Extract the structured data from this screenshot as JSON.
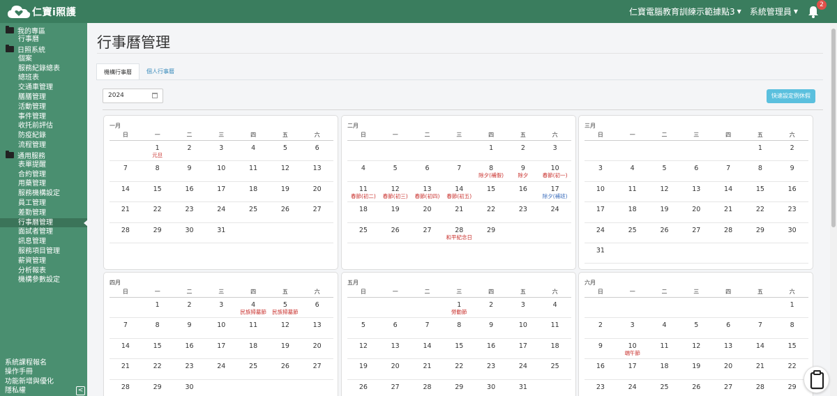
{
  "header": {
    "logo_text": "仁寶i照護",
    "org_selector": "仁寶電腦教育訓練示範據點3",
    "user_menu": "系統管理員",
    "notification_count": "2"
  },
  "sidebar": {
    "groups": [
      {
        "label": "我的專區",
        "items": [
          "行事曆"
        ]
      },
      {
        "label": "日照系統",
        "items": [
          "個案",
          "服務紀錄總表",
          "總班表",
          "交通車管理",
          "膳膳管理",
          "活動管理",
          "事件管理",
          "收托前評估",
          "防疫紀錄",
          "流程管理"
        ]
      },
      {
        "label": "通用服務",
        "items": [
          "表單提醒",
          "合約管理",
          "用藥管理",
          "服務機構設定",
          "員工管理",
          "差勤管理",
          "行事曆管理",
          "面試者管理",
          "訊息管理",
          "服務項目管理",
          "薪資管理",
          "分析報表",
          "機構參數設定"
        ]
      }
    ],
    "active_item": "行事曆管理",
    "bottom_links": [
      "系統課程報名",
      "操作手冊",
      "功能新增與優化",
      "隱私權"
    ]
  },
  "page": {
    "title": "行事曆管理",
    "tabs": [
      "機構行事曆",
      "個人行事曆"
    ],
    "year": "2024",
    "quick_button": "快速設定例休假"
  },
  "calendar": {
    "weekdays": [
      "日",
      "一",
      "二",
      "三",
      "四",
      "五",
      "六"
    ],
    "months": [
      {
        "name": "一月",
        "weeks": [
          [
            {
              "d": ""
            },
            {
              "d": "1",
              "n": "元旦"
            },
            {
              "d": "2"
            },
            {
              "d": "3"
            },
            {
              "d": "4"
            },
            {
              "d": "5"
            },
            {
              "d": "6"
            }
          ],
          [
            {
              "d": "7"
            },
            {
              "d": "8"
            },
            {
              "d": "9"
            },
            {
              "d": "10"
            },
            {
              "d": "11"
            },
            {
              "d": "12"
            },
            {
              "d": "13"
            }
          ],
          [
            {
              "d": "14"
            },
            {
              "d": "15"
            },
            {
              "d": "16"
            },
            {
              "d": "17"
            },
            {
              "d": "18"
            },
            {
              "d": "19"
            },
            {
              "d": "20"
            }
          ],
          [
            {
              "d": "21"
            },
            {
              "d": "22"
            },
            {
              "d": "23"
            },
            {
              "d": "24"
            },
            {
              "d": "25"
            },
            {
              "d": "26"
            },
            {
              "d": "27"
            }
          ],
          [
            {
              "d": "28"
            },
            {
              "d": "29"
            },
            {
              "d": "30"
            },
            {
              "d": "31"
            },
            {
              "d": ""
            },
            {
              "d": ""
            },
            {
              "d": ""
            }
          ]
        ]
      },
      {
        "name": "二月",
        "weeks": [
          [
            {
              "d": ""
            },
            {
              "d": ""
            },
            {
              "d": ""
            },
            {
              "d": ""
            },
            {
              "d": "1"
            },
            {
              "d": "2"
            },
            {
              "d": "3"
            }
          ],
          [
            {
              "d": "4"
            },
            {
              "d": "5"
            },
            {
              "d": "6"
            },
            {
              "d": "7"
            },
            {
              "d": "8",
              "n": "除夕(補假)"
            },
            {
              "d": "9",
              "n": "除夕"
            },
            {
              "d": "10",
              "n": "春節(初一)"
            }
          ],
          [
            {
              "d": "11",
              "n": "春節(初二)"
            },
            {
              "d": "12",
              "n": "春節(初三)"
            },
            {
              "d": "13",
              "n": "春節(初四)"
            },
            {
              "d": "14",
              "n": "春節(初五)"
            },
            {
              "d": "15"
            },
            {
              "d": "16"
            },
            {
              "d": "17",
              "n": "除夕(補班)",
              "w": true
            }
          ],
          [
            {
              "d": "18"
            },
            {
              "d": "19"
            },
            {
              "d": "20"
            },
            {
              "d": "21"
            },
            {
              "d": "22"
            },
            {
              "d": "23"
            },
            {
              "d": "24"
            }
          ],
          [
            {
              "d": "25"
            },
            {
              "d": "26"
            },
            {
              "d": "27"
            },
            {
              "d": "28",
              "n": "和平紀念日"
            },
            {
              "d": "29"
            },
            {
              "d": ""
            },
            {
              "d": ""
            }
          ]
        ]
      },
      {
        "name": "三月",
        "weeks": [
          [
            {
              "d": ""
            },
            {
              "d": ""
            },
            {
              "d": ""
            },
            {
              "d": ""
            },
            {
              "d": ""
            },
            {
              "d": "1"
            },
            {
              "d": "2"
            }
          ],
          [
            {
              "d": "3"
            },
            {
              "d": "4"
            },
            {
              "d": "5"
            },
            {
              "d": "6"
            },
            {
              "d": "7"
            },
            {
              "d": "8"
            },
            {
              "d": "9"
            }
          ],
          [
            {
              "d": "10"
            },
            {
              "d": "11"
            },
            {
              "d": "12"
            },
            {
              "d": "13"
            },
            {
              "d": "14"
            },
            {
              "d": "15"
            },
            {
              "d": "16"
            }
          ],
          [
            {
              "d": "17"
            },
            {
              "d": "18"
            },
            {
              "d": "19"
            },
            {
              "d": "20"
            },
            {
              "d": "21"
            },
            {
              "d": "22"
            },
            {
              "d": "23"
            }
          ],
          [
            {
              "d": "24"
            },
            {
              "d": "25"
            },
            {
              "d": "26"
            },
            {
              "d": "27"
            },
            {
              "d": "28"
            },
            {
              "d": "29"
            },
            {
              "d": "30"
            }
          ],
          [
            {
              "d": "31"
            },
            {
              "d": ""
            },
            {
              "d": ""
            },
            {
              "d": ""
            },
            {
              "d": ""
            },
            {
              "d": ""
            },
            {
              "d": ""
            }
          ]
        ]
      },
      {
        "name": "四月",
        "weeks": [
          [
            {
              "d": ""
            },
            {
              "d": "1"
            },
            {
              "d": "2"
            },
            {
              "d": "3"
            },
            {
              "d": "4",
              "n": "民族掃墓節"
            },
            {
              "d": "5",
              "n": "民族掃墓節"
            },
            {
              "d": "6"
            }
          ],
          [
            {
              "d": "7"
            },
            {
              "d": "8"
            },
            {
              "d": "9"
            },
            {
              "d": "10"
            },
            {
              "d": "11"
            },
            {
              "d": "12"
            },
            {
              "d": "13"
            }
          ],
          [
            {
              "d": "14"
            },
            {
              "d": "15"
            },
            {
              "d": "16"
            },
            {
              "d": "17"
            },
            {
              "d": "18"
            },
            {
              "d": "19"
            },
            {
              "d": "20"
            }
          ],
          [
            {
              "d": "21"
            },
            {
              "d": "22"
            },
            {
              "d": "23"
            },
            {
              "d": "24"
            },
            {
              "d": "25"
            },
            {
              "d": "26"
            },
            {
              "d": "27"
            }
          ],
          [
            {
              "d": "28"
            },
            {
              "d": "29"
            },
            {
              "d": "30"
            },
            {
              "d": ""
            },
            {
              "d": ""
            },
            {
              "d": ""
            },
            {
              "d": ""
            }
          ]
        ]
      },
      {
        "name": "五月",
        "weeks": [
          [
            {
              "d": ""
            },
            {
              "d": ""
            },
            {
              "d": ""
            },
            {
              "d": "1",
              "n": "勞動節"
            },
            {
              "d": "2"
            },
            {
              "d": "3"
            },
            {
              "d": "4"
            }
          ],
          [
            {
              "d": "5"
            },
            {
              "d": "6"
            },
            {
              "d": "7"
            },
            {
              "d": "8"
            },
            {
              "d": "9"
            },
            {
              "d": "10"
            },
            {
              "d": "11"
            }
          ],
          [
            {
              "d": "12"
            },
            {
              "d": "13"
            },
            {
              "d": "14"
            },
            {
              "d": "15"
            },
            {
              "d": "16"
            },
            {
              "d": "17"
            },
            {
              "d": "18"
            }
          ],
          [
            {
              "d": "19"
            },
            {
              "d": "20"
            },
            {
              "d": "21"
            },
            {
              "d": "22"
            },
            {
              "d": "23"
            },
            {
              "d": "24"
            },
            {
              "d": "25"
            }
          ],
          [
            {
              "d": "26"
            },
            {
              "d": "27"
            },
            {
              "d": "28"
            },
            {
              "d": "29"
            },
            {
              "d": "30"
            },
            {
              "d": "31"
            },
            {
              "d": ""
            }
          ]
        ]
      },
      {
        "name": "六月",
        "weeks": [
          [
            {
              "d": ""
            },
            {
              "d": ""
            },
            {
              "d": ""
            },
            {
              "d": ""
            },
            {
              "d": ""
            },
            {
              "d": ""
            },
            {
              "d": "1"
            }
          ],
          [
            {
              "d": "2"
            },
            {
              "d": "3"
            },
            {
              "d": "4"
            },
            {
              "d": "5"
            },
            {
              "d": "6"
            },
            {
              "d": "7"
            },
            {
              "d": "8"
            }
          ],
          [
            {
              "d": "9"
            },
            {
              "d": "10",
              "n": "端午節"
            },
            {
              "d": "11"
            },
            {
              "d": "12"
            },
            {
              "d": "13"
            },
            {
              "d": "14"
            },
            {
              "d": "15"
            }
          ],
          [
            {
              "d": "16"
            },
            {
              "d": "17"
            },
            {
              "d": "18"
            },
            {
              "d": "19"
            },
            {
              "d": "20"
            },
            {
              "d": "21"
            },
            {
              "d": "22"
            }
          ],
          [
            {
              "d": "23"
            },
            {
              "d": "24"
            },
            {
              "d": "25"
            },
            {
              "d": "26"
            },
            {
              "d": "27"
            },
            {
              "d": "28"
            },
            {
              "d": "29"
            }
          ]
        ]
      }
    ]
  }
}
